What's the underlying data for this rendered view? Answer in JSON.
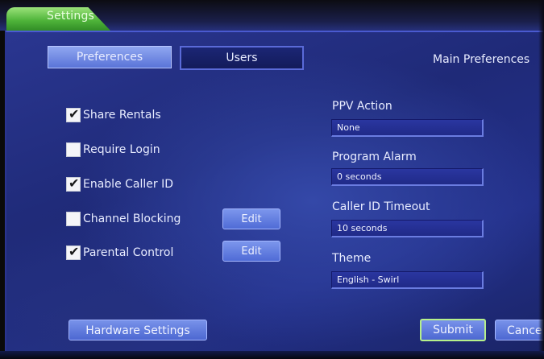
{
  "window": {
    "title": "Settings"
  },
  "tabs": [
    {
      "label": "Preferences",
      "active": true
    },
    {
      "label": "Users",
      "active": false
    }
  ],
  "section_heading": "Main Preferences",
  "checkboxes": [
    {
      "label": "Share Rentals",
      "checked": true,
      "check_glyph": "✔"
    },
    {
      "label": "Require Login",
      "checked": false,
      "check_glyph": ""
    },
    {
      "label": "Enable Caller ID",
      "checked": true,
      "check_glyph": "✔"
    },
    {
      "label": "Channel Blocking",
      "checked": false,
      "check_glyph": ""
    },
    {
      "label": "Parental Control",
      "checked": true,
      "check_glyph": "✔"
    }
  ],
  "edit_buttons": {
    "channel_blocking": "Edit",
    "parental_control": "Edit"
  },
  "fields": [
    {
      "label": "PPV Action",
      "value": "None"
    },
    {
      "label": "Program Alarm",
      "value": "0 seconds"
    },
    {
      "label": "Caller ID Timeout",
      "value": "10 seconds"
    },
    {
      "label": "Theme",
      "value": "English - Swirl"
    }
  ],
  "buttons": {
    "hardware_settings": "Hardware Settings",
    "submit": "Submit",
    "cancel": "Cance"
  },
  "colors": {
    "title_tab": "#4fb43a",
    "panel": "#23308a",
    "button": "#5a74d8",
    "focus_outline": "#b6f08a"
  },
  "icons": {
    "checkbox_checked": "checkmark-icon"
  }
}
